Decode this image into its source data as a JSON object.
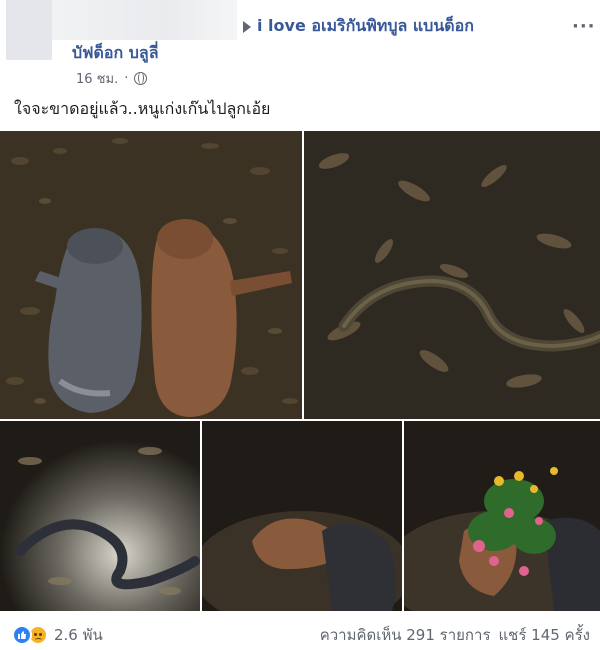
{
  "header": {
    "group_name": "i love อเมริกันพิทบูล แบนด็อก",
    "author": "บัฟด็อก บลูลี่",
    "time": "16 ชม.",
    "more_icon": "more-icon",
    "privacy_icon": "globe-icon"
  },
  "post": {
    "text": "ใจจะขาดอยู่แล้ว..หนูเก่งเก๊นไปลูกเอ้ย"
  },
  "photos": [
    {
      "id": "photo-1"
    },
    {
      "id": "photo-2"
    },
    {
      "id": "photo-3"
    },
    {
      "id": "photo-4"
    },
    {
      "id": "photo-5"
    }
  ],
  "footer": {
    "reaction_icons": [
      "like-icon",
      "sad-icon"
    ],
    "reaction_count": "2.6 พัน",
    "comments": "ความคิดเห็น 291 รายการ",
    "shares": "แชร์ 145 ครั้ง"
  },
  "colors": {
    "link": "#385898",
    "meta": "#606770",
    "like": "#2e81f4",
    "sad": "#f7b125"
  }
}
